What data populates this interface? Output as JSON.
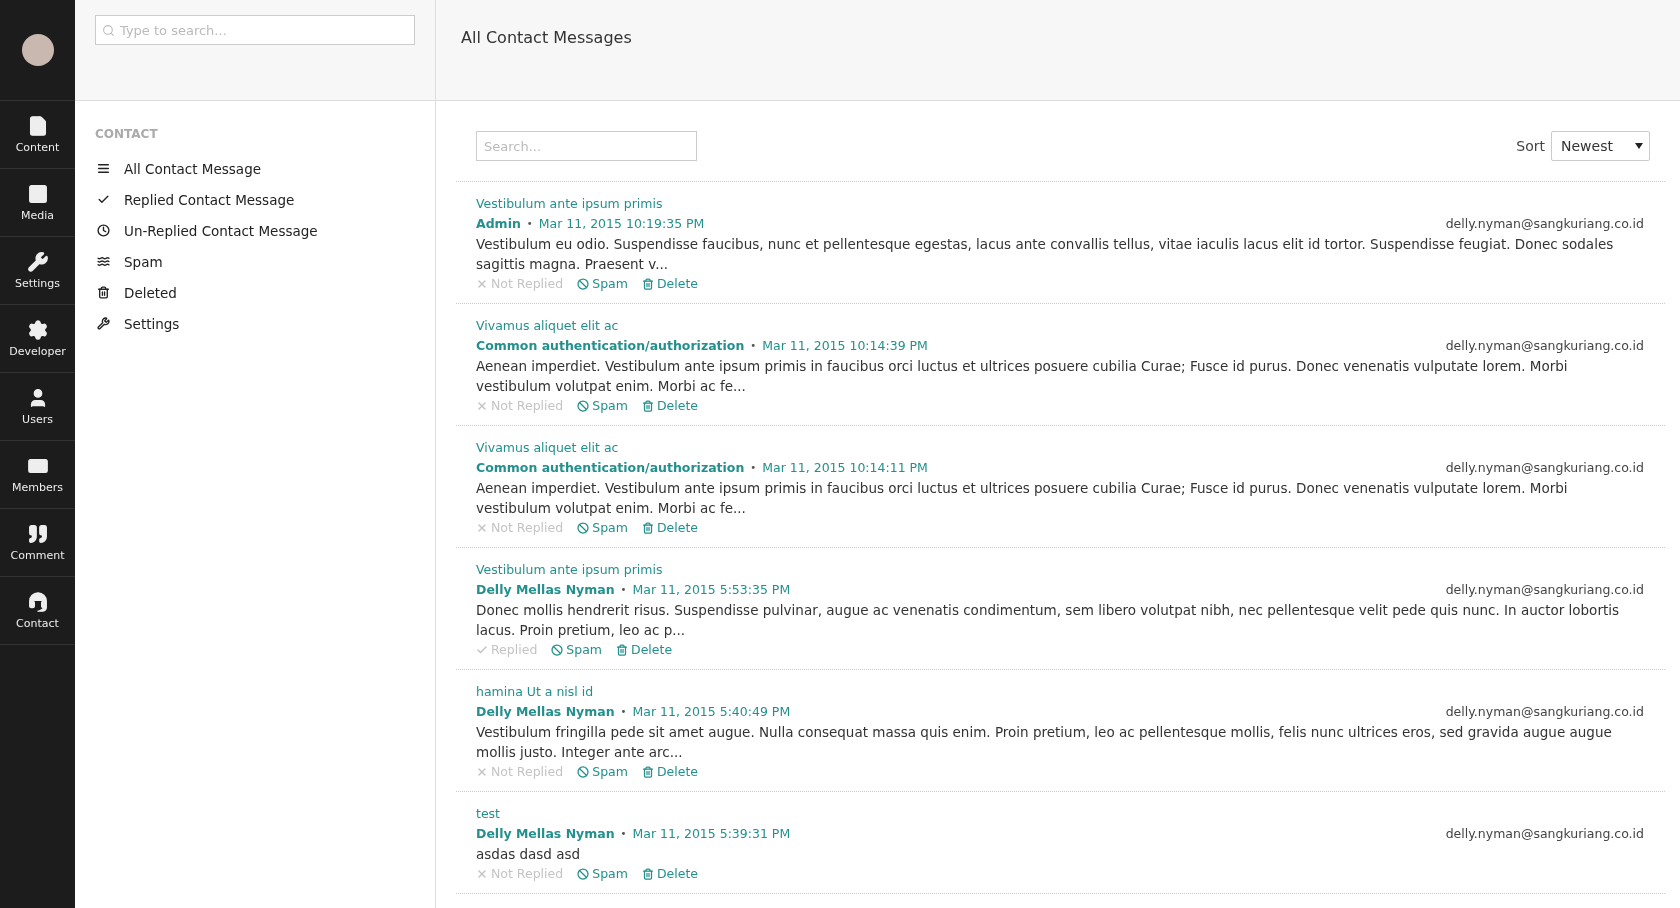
{
  "rail": {
    "items": [
      {
        "label": "Content"
      },
      {
        "label": "Media"
      },
      {
        "label": "Settings"
      },
      {
        "label": "Developer"
      },
      {
        "label": "Users"
      },
      {
        "label": "Members"
      },
      {
        "label": "Comment"
      },
      {
        "label": "Contact"
      }
    ]
  },
  "tree": {
    "search_placeholder": "Type to search...",
    "heading": "CONTACT",
    "items": [
      {
        "label": "All Contact Message"
      },
      {
        "label": "Replied Contact Message"
      },
      {
        "label": "Un-Replied Contact Message"
      },
      {
        "label": "Spam"
      },
      {
        "label": "Deleted"
      },
      {
        "label": "Settings"
      }
    ]
  },
  "main": {
    "title": "All Contact Messages",
    "search_placeholder": "Search...",
    "sort_label": "Sort",
    "sort_value": "Newest",
    "messages": [
      {
        "subject": "Vestibulum ante ipsum primis",
        "author": "Admin",
        "separator": "•",
        "date": "Mar 11, 2015 10:19:35 PM",
        "email": "delly.nyman@sangkuriang.co.id",
        "body": "Vestibulum eu odio. Suspendisse faucibus, nunc et pellentesque egestas, lacus ante convallis tellus, vitae  iaculis lacus elit id tortor. Suspendisse feugiat. Donec sodales sagittis magna. Praesent v...",
        "replied": false,
        "status": "Not Replied",
        "spam": "Spam",
        "delete": "Delete"
      },
      {
        "subject": "Vivamus aliquet elit ac",
        "author": "Common authentication/authorization",
        "separator": "•",
        "date": "Mar 11, 2015 10:14:39 PM",
        "email": "delly.nyman@sangkuriang.co.id",
        "body": "Aenean imperdiet. Vestibulum ante ipsum primis in faucibus orci luctus et ultrices posuere cubilia Curae;  Fusce id purus. Donec venenatis vulputate lorem. Morbi vestibulum volutpat enim. Morbi ac fe...",
        "replied": false,
        "status": "Not Replied",
        "spam": "Spam",
        "delete": "Delete"
      },
      {
        "subject": "Vivamus aliquet elit ac",
        "author": "Common authentication/authorization",
        "separator": "•",
        "date": "Mar 11, 2015 10:14:11 PM",
        "email": "delly.nyman@sangkuriang.co.id",
        "body": "Aenean imperdiet. Vestibulum ante ipsum primis in faucibus orci luctus et ultrices posuere cubilia Curae;  Fusce id purus. Donec venenatis vulputate lorem. Morbi vestibulum volutpat enim. Morbi ac fe...",
        "replied": false,
        "status": "Not Replied",
        "spam": "Spam",
        "delete": "Delete"
      },
      {
        "subject": "Vestibulum ante ipsum primis",
        "author": "Delly Mellas Nyman",
        "separator": "•",
        "date": "Mar 11, 2015 5:53:35 PM",
        "email": "delly.nyman@sangkuriang.co.id",
        "body": "Donec mollis hendrerit risus. Suspendisse pulvinar, augue ac venenatis condimentum, sem libero volutpat nibh,  nec pellentesque velit pede quis nunc. In auctor lobortis lacus. Proin pretium, leo ac p...",
        "replied": true,
        "status": "Replied",
        "spam": "Spam",
        "delete": "Delete"
      },
      {
        "subject": "hamina Ut a nisl id",
        "author": "Delly Mellas Nyman",
        "separator": "•",
        "date": "Mar 11, 2015 5:40:49 PM",
        "email": "delly.nyman@sangkuriang.co.id",
        "body": "Vestibulum fringilla pede sit amet augue. Nulla consequat massa quis enim. Proin pretium, leo ac  pellentesque mollis, felis nunc ultrices eros, sed gravida augue augue mollis justo. Integer ante arc...",
        "replied": false,
        "status": "Not Replied",
        "spam": "Spam",
        "delete": "Delete"
      },
      {
        "subject": "test",
        "author": "Delly Mellas Nyman",
        "separator": "•",
        "date": "Mar 11, 2015 5:39:31 PM",
        "email": "delly.nyman@sangkuriang.co.id",
        "body": "asdas dasd asd",
        "replied": false,
        "status": "Not Replied",
        "spam": "Spam",
        "delete": "Delete"
      }
    ]
  }
}
